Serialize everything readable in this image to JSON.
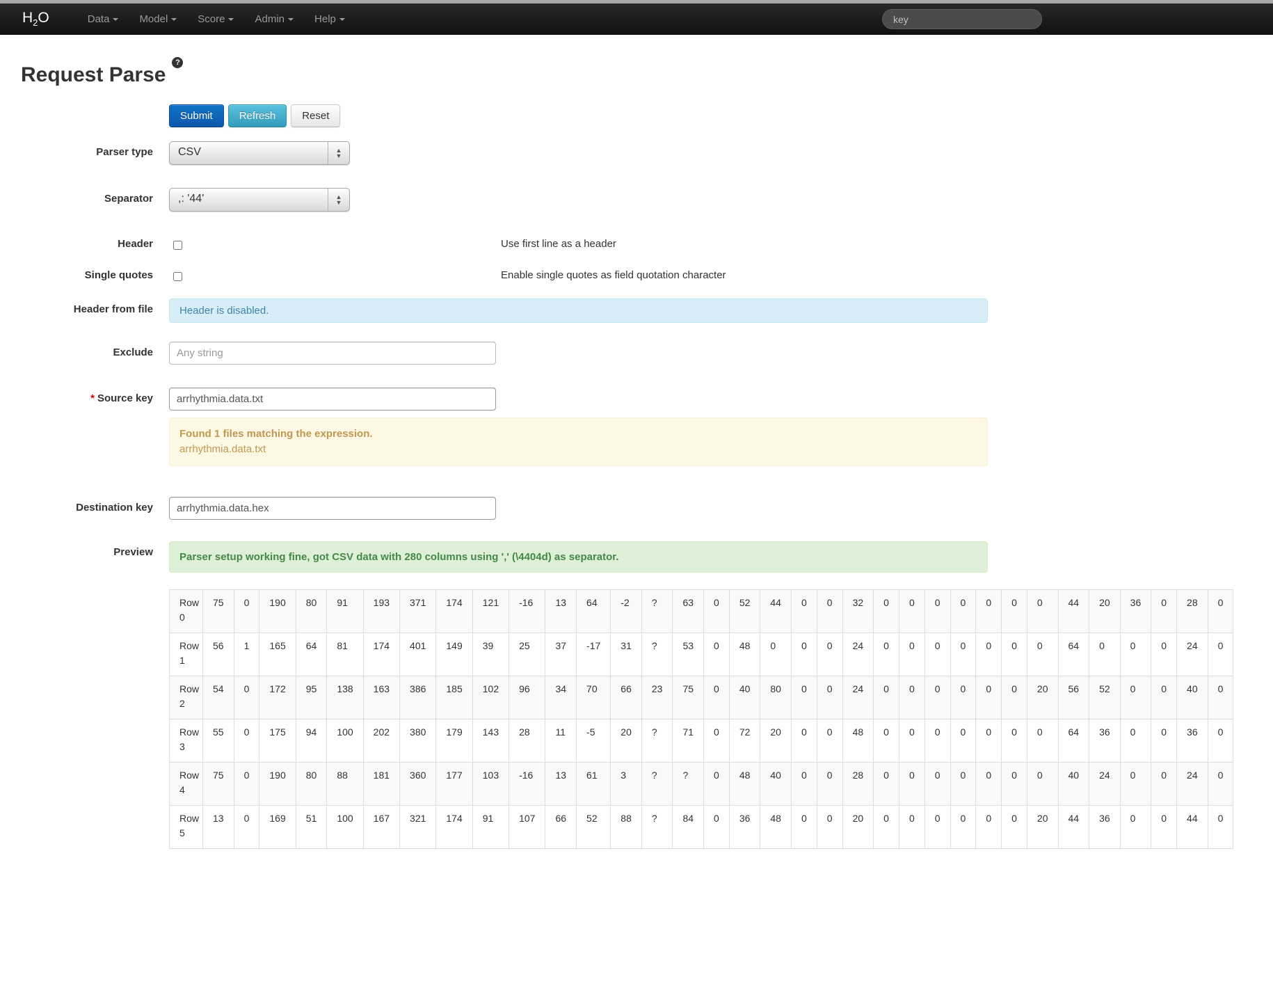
{
  "navbar": {
    "brand_h": "H",
    "brand_sub": "2",
    "brand_o": "O",
    "items": [
      {
        "label": "Data"
      },
      {
        "label": "Model"
      },
      {
        "label": "Score"
      },
      {
        "label": "Admin"
      },
      {
        "label": "Help"
      }
    ],
    "search_placeholder": "key"
  },
  "page": {
    "title": "Request Parse",
    "help_glyph": "?"
  },
  "toolbar": {
    "submit_label": "Submit",
    "refresh_label": "Refresh",
    "reset_label": "Reset"
  },
  "form": {
    "parser_type": {
      "label": "Parser type",
      "value": "CSV"
    },
    "separator": {
      "label": "Separator",
      "value": ",: '44'"
    },
    "header": {
      "label": "Header",
      "help": "Use first line as a header"
    },
    "single_quotes": {
      "label": "Single quotes",
      "help": "Enable single quotes as field quotation character"
    },
    "header_from_file": {
      "label": "Header from file",
      "message": "Header is disabled."
    },
    "exclude": {
      "label": "Exclude",
      "placeholder": "Any string"
    },
    "source_key": {
      "label": "Source key",
      "required_mark": "*",
      "value": "arrhythmia.data.txt"
    },
    "source_key_info": {
      "title": "Found 1 files matching the expression.",
      "file": "arrhythmia.data.txt"
    },
    "destination_key": {
      "label": "Destination key",
      "value": "arrhythmia.data.hex"
    },
    "preview": {
      "label": "Preview",
      "message": "Parser setup working fine, got CSV data with 280 columns using ',' (\\4404d) as separator."
    }
  },
  "preview_table": {
    "rows": [
      {
        "label": "Row 0",
        "values": [
          "75",
          "0",
          "190",
          "80",
          "91",
          "193",
          "371",
          "174",
          "121",
          "-16",
          "13",
          "64",
          "-2",
          "?",
          "63",
          "0",
          "52",
          "44",
          "0",
          "0",
          "32",
          "0",
          "0",
          "0",
          "0",
          "0",
          "0",
          "0",
          "44",
          "20",
          "36",
          "0",
          "28",
          "0"
        ]
      },
      {
        "label": "Row 1",
        "values": [
          "56",
          "1",
          "165",
          "64",
          "81",
          "174",
          "401",
          "149",
          "39",
          "25",
          "37",
          "-17",
          "31",
          "?",
          "53",
          "0",
          "48",
          "0",
          "0",
          "0",
          "24",
          "0",
          "0",
          "0",
          "0",
          "0",
          "0",
          "0",
          "64",
          "0",
          "0",
          "0",
          "24",
          "0"
        ]
      },
      {
        "label": "Row 2",
        "values": [
          "54",
          "0",
          "172",
          "95",
          "138",
          "163",
          "386",
          "185",
          "102",
          "96",
          "34",
          "70",
          "66",
          "23",
          "75",
          "0",
          "40",
          "80",
          "0",
          "0",
          "24",
          "0",
          "0",
          "0",
          "0",
          "0",
          "0",
          "20",
          "56",
          "52",
          "0",
          "0",
          "40",
          "0"
        ]
      },
      {
        "label": "Row 3",
        "values": [
          "55",
          "0",
          "175",
          "94",
          "100",
          "202",
          "380",
          "179",
          "143",
          "28",
          "11",
          "-5",
          "20",
          "?",
          "71",
          "0",
          "72",
          "20",
          "0",
          "0",
          "48",
          "0",
          "0",
          "0",
          "0",
          "0",
          "0",
          "0",
          "64",
          "36",
          "0",
          "0",
          "36",
          "0"
        ]
      },
      {
        "label": "Row 4",
        "values": [
          "75",
          "0",
          "190",
          "80",
          "88",
          "181",
          "360",
          "177",
          "103",
          "-16",
          "13",
          "61",
          "3",
          "?",
          "?",
          "0",
          "48",
          "40",
          "0",
          "0",
          "28",
          "0",
          "0",
          "0",
          "0",
          "0",
          "0",
          "0",
          "40",
          "24",
          "0",
          "0",
          "24",
          "0"
        ]
      },
      {
        "label": "Row 5",
        "values": [
          "13",
          "0",
          "169",
          "51",
          "100",
          "167",
          "321",
          "174",
          "91",
          "107",
          "66",
          "52",
          "88",
          "?",
          "84",
          "0",
          "36",
          "48",
          "0",
          "0",
          "20",
          "0",
          "0",
          "0",
          "0",
          "0",
          "0",
          "20",
          "44",
          "36",
          "0",
          "0",
          "44",
          "0"
        ]
      }
    ]
  },
  "colors": {
    "primary_button": "#0e57ad",
    "info_button": "#49afcd",
    "alert_info_text": "#3a87ad",
    "alert_warning_text": "#c09853",
    "alert_success_text": "#468847"
  }
}
